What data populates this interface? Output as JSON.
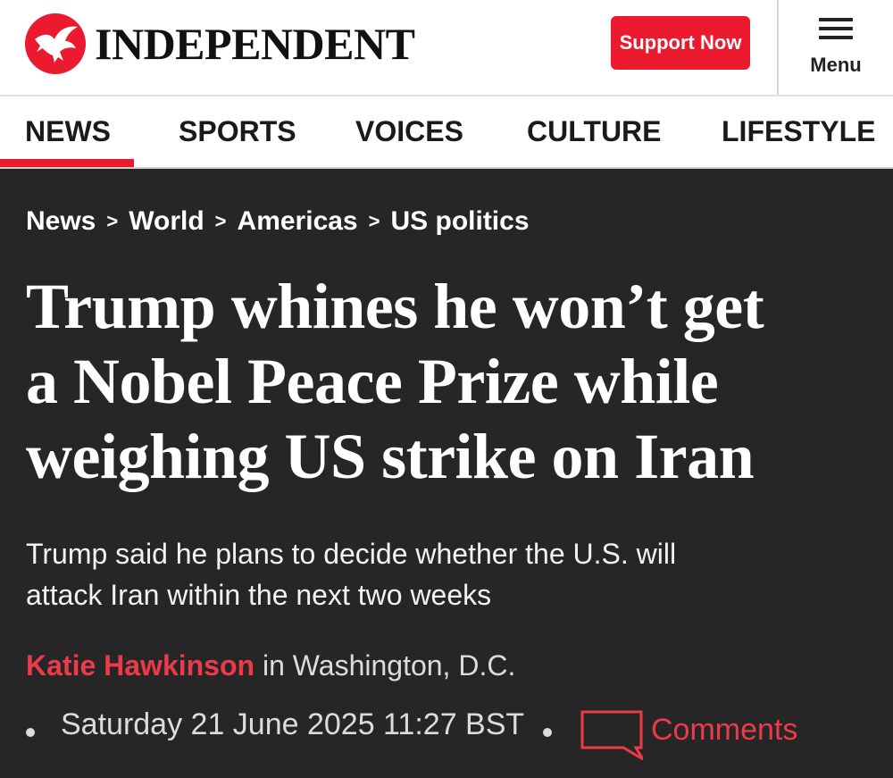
{
  "header": {
    "logo_text": "INDEPENDENT",
    "support_label": "Support Now",
    "menu_label": "Menu"
  },
  "nav": {
    "items": [
      "NEWS",
      "SPORTS",
      "VOICES",
      "CULTURE",
      "LIFESTYLE"
    ],
    "active": "NEWS"
  },
  "breadcrumb": [
    "News",
    "World",
    "Americas",
    "US politics"
  ],
  "breadcrumb_separator": ">",
  "article": {
    "headline_line1": "Trump whines he won’t get",
    "headline_line2": "a Nobel Peace Prize while",
    "headline_line3": "weighing US strike on Iran",
    "standfirst_line1": "Trump said he plans to decide whether the U.S. will",
    "standfirst_line2": "attack Iran within the next two weeks",
    "author": "Katie Hawkinson",
    "location": " in Washington, D.C.",
    "date": "Saturday 21 June 2025 11:27 BST",
    "comments_label": "Comments"
  },
  "colors": {
    "brand_red": "#ec1a2e",
    "hero_bg": "#262626",
    "accent_text": "#ec3a4a"
  },
  "icons": [
    "eagle-logo-icon",
    "hamburger-menu-icon",
    "comment-bubble-icon"
  ]
}
